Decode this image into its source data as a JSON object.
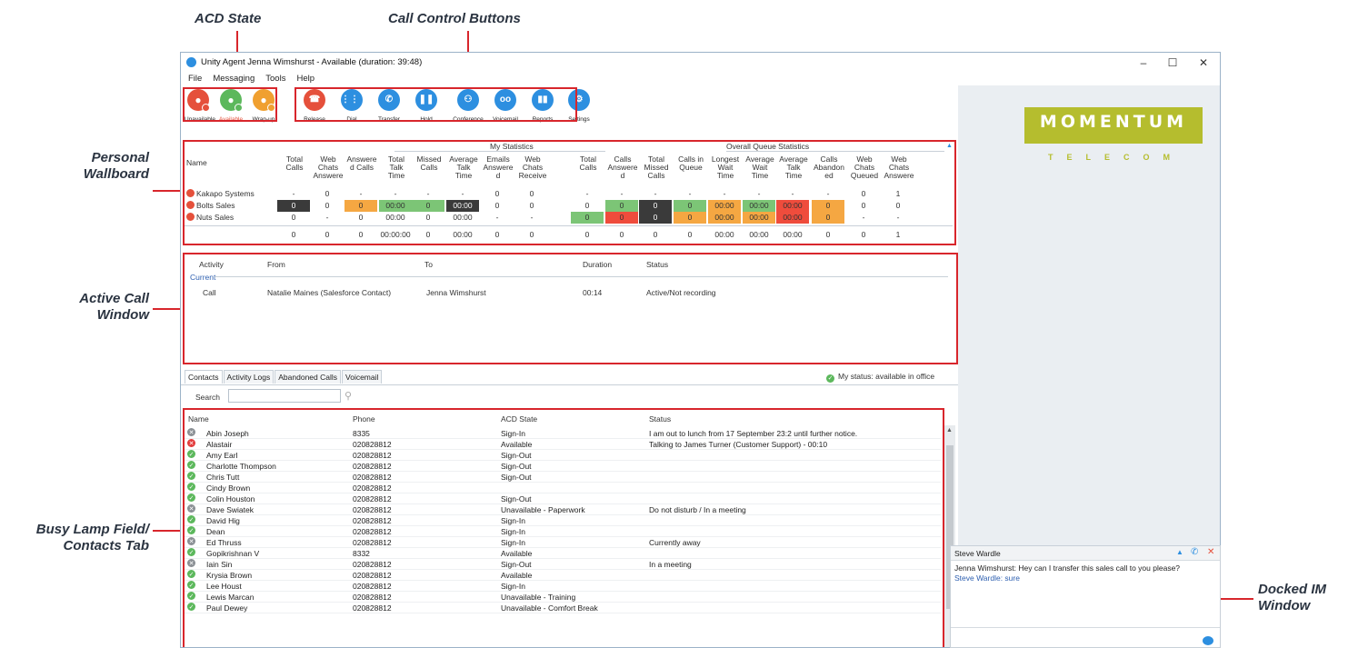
{
  "annotations": {
    "acd_state": "ACD State",
    "call_control": "Call Control Buttons",
    "personal_wallboard": [
      "Personal",
      "Wallboard"
    ],
    "active_call": [
      "Active Call",
      "Window"
    ],
    "blf": [
      "Busy Lamp Field/",
      "Contacts Tab"
    ],
    "docked_im": [
      "Docked IM",
      "Window"
    ]
  },
  "window": {
    "title": "Unity Agent Jenna Wimshurst - Available (duration: 39:48)",
    "minimize": "–",
    "maximize": "☐",
    "close": "✕"
  },
  "menu": [
    "File",
    "Messaging",
    "Tools",
    "Help"
  ],
  "acd_buttons": [
    {
      "label": "Unavailable",
      "color": "#e5503b",
      "badge": "#e5503b"
    },
    {
      "label": "Available",
      "color": "#5cb85c",
      "badge": "#5cb85c"
    },
    {
      "label": "Wrap-up",
      "color": "#f0a030",
      "badge": "#f0a030"
    }
  ],
  "call_buttons": [
    {
      "label": "Release",
      "color": "#e5503b",
      "icon": "☎"
    },
    {
      "label": "Dial",
      "color": "#2d8fe0",
      "icon": "⋮⋮⋮"
    },
    {
      "label": "Transfer",
      "color": "#2d8fe0",
      "icon": "✆"
    },
    {
      "label": "Hold",
      "color": "#2d8fe0",
      "icon": "❚❚"
    },
    {
      "label": "Conference",
      "color": "#2d8fe0",
      "icon": "⚇"
    },
    {
      "label": "Voicemail",
      "color": "#2d8fe0",
      "icon": "oo"
    },
    {
      "label": "Reports",
      "color": "#2d8fe0",
      "icon": "▮▮"
    },
    {
      "label": "Settings",
      "color": "#2d8fe0",
      "icon": "⚙"
    }
  ],
  "logo": {
    "main": "MOMENTUM",
    "sub": "TELECOM"
  },
  "wallboard": {
    "group_my": "My Statistics",
    "group_queue": "Overall Queue Statistics",
    "name_header": "Name",
    "columns": [
      "Total\nCalls",
      "Web\nChats\nAnswere",
      "Answere\nd Calls",
      "Total\nTalk\nTime",
      "Missed\nCalls",
      "Average\nTalk\nTime",
      "Emails\nAnswere\nd",
      "Web\nChats\nReceive",
      "Total\nCalls",
      "Calls\nAnswere\nd",
      "Total\nMissed\nCalls",
      "Calls in\nQueue",
      "Longest\nWait\nTime",
      "Average\nWait\nTime",
      "Average\nTalk\nTime",
      "Calls\nAbandon\ned",
      "Web\nChats\nQueued",
      "Web\nChats\nAnswere"
    ],
    "rows": [
      {
        "name": "Kakapo Systems",
        "cells": [
          "-",
          "0",
          "-",
          "-",
          "-",
          "-",
          "0",
          "0",
          "-",
          "-",
          "-",
          "-",
          "-",
          "-",
          "-",
          "-",
          "0",
          "1"
        ],
        "colors": [
          "",
          "",
          "",
          "",
          "",
          "",
          "",
          "",
          "",
          "",
          "",
          "",
          "",
          "",
          "",
          "",
          "",
          ""
        ]
      },
      {
        "name": "Bolts Sales",
        "cells": [
          "0",
          "0",
          "0",
          "00:00",
          "0",
          "00:00",
          "0",
          "0",
          "0",
          "0",
          "0",
          "0",
          "00:00",
          "00:00",
          "00:00",
          "0",
          "0",
          "0"
        ],
        "colors": [
          "#3a3a3a",
          "",
          "#f5a742",
          "#7cc576",
          "#7cc576",
          "#3a3a3a",
          "",
          "",
          "",
          "#7cc576",
          "#3a3a3a",
          "#7cc576",
          "#f5a742",
          "#7cc576",
          "#ef4c3c",
          "#f5a742",
          "",
          ""
        ]
      },
      {
        "name": "Nuts Sales",
        "cells": [
          "0",
          "-",
          "0",
          "00:00",
          "0",
          "00:00",
          "-",
          "-",
          "0",
          "0",
          "0",
          "0",
          "00:00",
          "00:00",
          "00:00",
          "0",
          "-",
          "-"
        ],
        "colors": [
          "",
          "",
          "",
          "",
          "",
          "",
          "",
          "",
          "#7cc576",
          "#ef4c3c",
          "#3a3a3a",
          "#f5a742",
          "#f5a742",
          "#f5a742",
          "#ef4c3c",
          "#f5a742",
          "",
          ""
        ]
      }
    ],
    "totals": [
      "0",
      "0",
      "0",
      "00:00:00",
      "0",
      "00:00",
      "0",
      "0",
      "0",
      "0",
      "0",
      "0",
      "00:00",
      "00:00",
      "00:00",
      "0",
      "0",
      "1"
    ]
  },
  "active_call": {
    "headers": {
      "activity": "Activity",
      "from": "From",
      "to": "To",
      "duration": "Duration",
      "status": "Status"
    },
    "section": "Current",
    "row": {
      "activity": "Call",
      "from": "Natalie Maines (Salesforce Contact)",
      "to": "Jenna Wimshurst",
      "duration": "00:14",
      "status": "Active/Not recording"
    }
  },
  "tabs": [
    "Contacts",
    "Activity Logs",
    "Abandoned Calls",
    "Voicemail"
  ],
  "my_status": "My status: available in office",
  "search_label": "Search",
  "contacts": {
    "headers": {
      "name": "Name",
      "phone": "Phone",
      "acd": "ACD State",
      "status": "Status"
    },
    "rows": [
      {
        "s": "grey",
        "name": "Abin Joseph",
        "phone": "8335",
        "acd": "Sign-In",
        "status": "I am out to lunch from 17 September 23:2 until further notice."
      },
      {
        "s": "red",
        "name": "Alastair",
        "phone": "020828812",
        "acd": "Available",
        "status": "Talking to James Turner (Customer Support) - 00:10"
      },
      {
        "s": "green",
        "name": "Amy Earl",
        "phone": "020828812",
        "acd": "Sign-Out",
        "status": ""
      },
      {
        "s": "green",
        "name": "Charlotte Thompson",
        "phone": "020828812",
        "acd": "Sign-Out",
        "status": ""
      },
      {
        "s": "green",
        "name": "Chris Tutt",
        "phone": "020828812",
        "acd": "Sign-Out",
        "status": ""
      },
      {
        "s": "green",
        "name": "Cindy Brown",
        "phone": "020828812",
        "acd": "",
        "status": ""
      },
      {
        "s": "green",
        "name": "Colin Houston",
        "phone": "020828812",
        "acd": "Sign-Out",
        "status": ""
      },
      {
        "s": "grey",
        "name": "Dave Swiatek",
        "phone": "020828812",
        "acd": "Unavailable - Paperwork",
        "status": "Do not disturb / In a meeting"
      },
      {
        "s": "green",
        "name": "David Hig",
        "phone": "020828812",
        "acd": "Sign-In",
        "status": ""
      },
      {
        "s": "green",
        "name": "Dean",
        "phone": "020828812",
        "acd": "Sign-In",
        "status": ""
      },
      {
        "s": "grey",
        "name": "Ed Thruss",
        "phone": "020828812",
        "acd": "Sign-In",
        "status": "Currently away"
      },
      {
        "s": "green",
        "name": "Gopikrishnan V",
        "phone": "8332",
        "acd": "Available",
        "status": ""
      },
      {
        "s": "grey",
        "name": "Iain Sin",
        "phone": "020828812",
        "acd": "Sign-Out",
        "status": "In a meeting"
      },
      {
        "s": "green",
        "name": "Krysia Brown",
        "phone": "020828812",
        "acd": "Available",
        "status": ""
      },
      {
        "s": "green",
        "name": "Lee Houst",
        "phone": "020828812",
        "acd": "Sign-In",
        "status": ""
      },
      {
        "s": "green",
        "name": "Lewis Marcan",
        "phone": "020828812",
        "acd": "Unavailable - Training",
        "status": ""
      },
      {
        "s": "green",
        "name": "Paul Dewey",
        "phone": "020828812",
        "acd": "Unavailable - Comfort Break",
        "status": ""
      }
    ]
  },
  "im": {
    "contact": "Steve Wardle",
    "line1": "Jenna Wimshurst: Hey can I transfer this sales call to you please?",
    "line2": "Steve Wardle: sure"
  }
}
